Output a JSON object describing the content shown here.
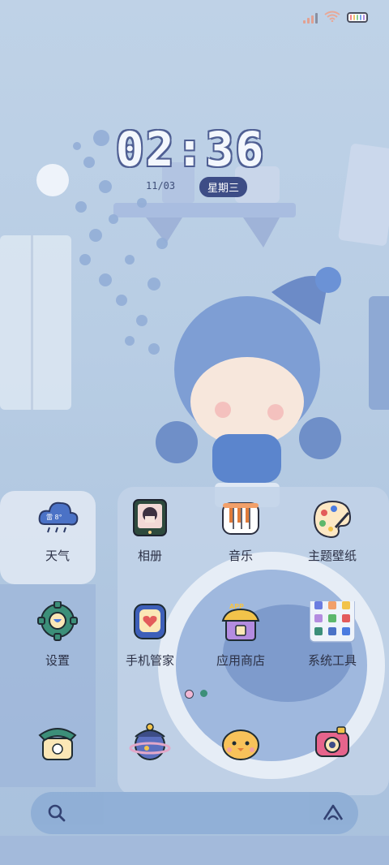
{
  "status_bar": {
    "icons": [
      "signal-icon",
      "wifi-icon",
      "battery-icon"
    ],
    "battery_colors": [
      "#f0868a",
      "#f0c36a",
      "#8ad08f",
      "#7aa6e8",
      "#b28ce0"
    ]
  },
  "lock_widget": {
    "time": "02:36",
    "date": "11/03",
    "weekday": "星期三"
  },
  "apps_row1": [
    {
      "label": "天气",
      "icon": "weather-cloud-icon",
      "weather_badge": "雷 8°"
    },
    {
      "label": "相册",
      "icon": "photo-frame-icon"
    },
    {
      "label": "音乐",
      "icon": "piano-keys-icon"
    },
    {
      "label": "主题壁纸",
      "icon": "paint-palette-icon"
    }
  ],
  "apps_row2": [
    {
      "label": "设置",
      "icon": "gear-icon"
    },
    {
      "label": "手机管家",
      "icon": "shield-heart-icon"
    },
    {
      "label": "应用商店",
      "icon": "app-store-house-icon"
    },
    {
      "label": "系统工具",
      "icon": "tools-folder-icon"
    }
  ],
  "dock": [
    {
      "icon": "phone-icon"
    },
    {
      "icon": "contacts-planet-icon"
    },
    {
      "icon": "messages-chick-icon"
    },
    {
      "icon": "camera-icon"
    }
  ],
  "page_indicator": {
    "pages": 2,
    "active": 0
  },
  "search_bar": {
    "left_icon": "search-icon",
    "right_icon": "assistant-icon"
  },
  "colors": {
    "accent": "#3d4d86",
    "wallpaper": "#b9cde3",
    "search_bar": "#8fafd6"
  }
}
